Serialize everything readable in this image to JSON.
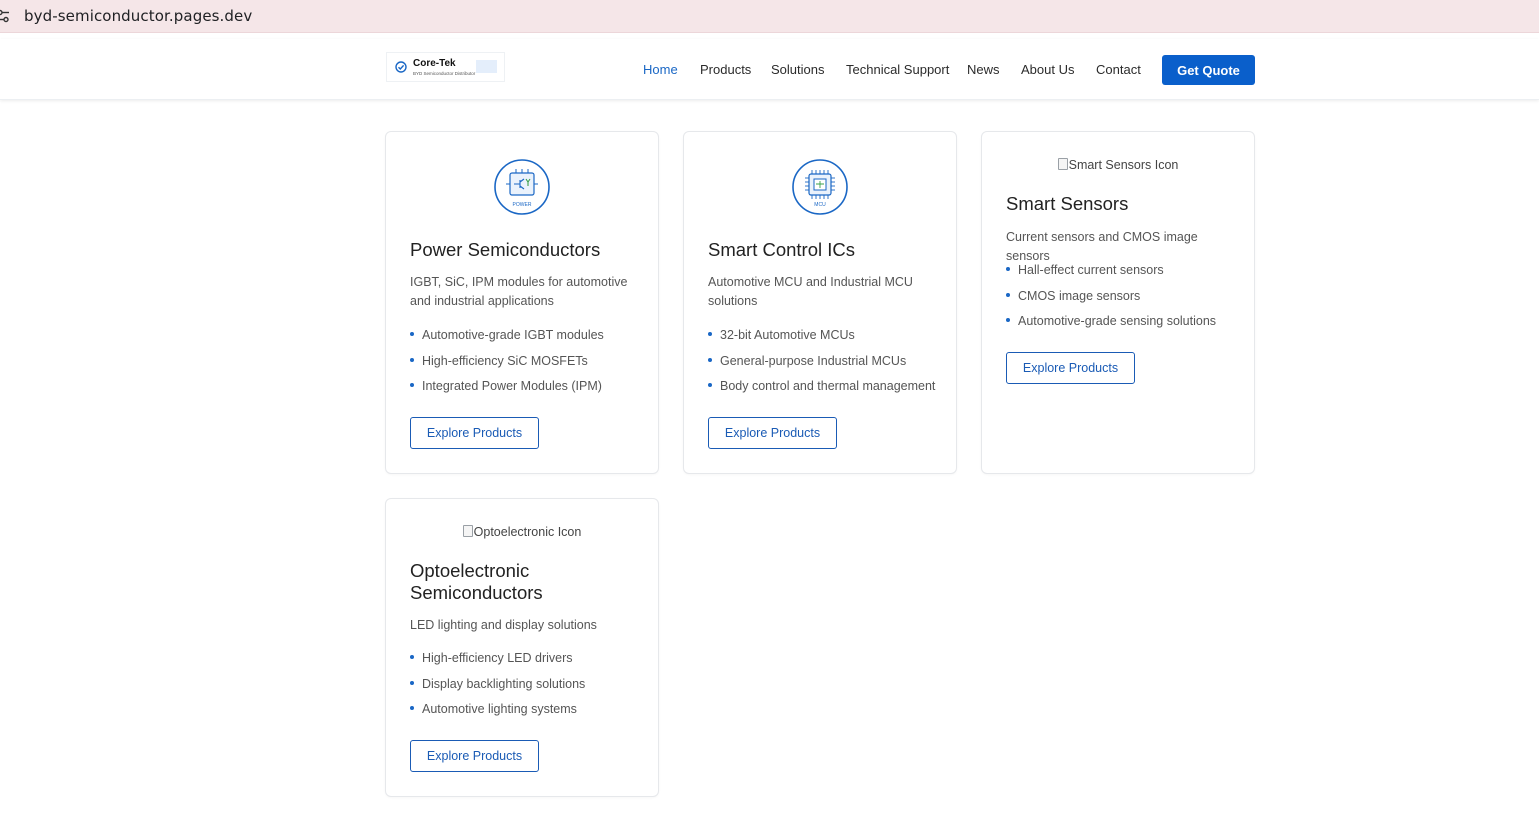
{
  "browser": {
    "url": "byd-semiconductor.pages.dev",
    "site_icon": "tune-icon"
  },
  "header": {
    "logo": {
      "name": "Core-Tek",
      "subtitle": "BYD Semiconductor Distributor",
      "icon": "check-circle-icon"
    },
    "nav": [
      {
        "label": "Home",
        "active": true
      },
      {
        "label": "Products",
        "active": false
      },
      {
        "label": "Solutions",
        "active": false
      },
      {
        "label": "Technical Support",
        "active": false
      },
      {
        "label": "News",
        "active": false
      },
      {
        "label": "About Us",
        "active": false
      },
      {
        "label": "Contact",
        "active": false
      }
    ],
    "cta_label": "Get Quote"
  },
  "colors": {
    "primary": "#0a5fcb",
    "link_active": "#1a67c5",
    "bullet": "#1a67c5",
    "urlbar_bg": "#f5e6e8"
  },
  "cards": [
    {
      "icon": {
        "type": "svg",
        "name": "power-chip-icon",
        "caption": "POWER"
      },
      "title": "Power Semiconductors",
      "description": "IGBT, SiC, IPM modules for automotive and industrial applications",
      "features": [
        "Automotive-grade IGBT modules",
        "High-efficiency SiC MOSFETs",
        "Integrated Power Modules (IPM)"
      ],
      "button": "Explore Products"
    },
    {
      "icon": {
        "type": "svg",
        "name": "mcu-chip-icon",
        "caption": "MCU"
      },
      "title": "Smart Control ICs",
      "description": "Automotive MCU and Industrial MCU solutions",
      "features": [
        "32-bit Automotive MCUs",
        "General-purpose Industrial MCUs",
        "Body control and thermal management"
      ],
      "button": "Explore Products"
    },
    {
      "icon": {
        "type": "broken",
        "alt": "Smart Sensors Icon"
      },
      "title": "Smart Sensors",
      "description": "Current sensors and CMOS image sensors",
      "features": [
        "Hall-effect current sensors",
        "CMOS image sensors",
        "Automotive-grade sensing solutions"
      ],
      "button": "Explore Products"
    },
    {
      "icon": {
        "type": "broken",
        "alt": "Optoelectronic Icon"
      },
      "title": "Optoelectronic Semiconductors",
      "description": "LED lighting and display solutions",
      "features": [
        "High-efficiency LED drivers",
        "Display backlighting solutions",
        "Automotive lighting systems"
      ],
      "button": "Explore Products"
    }
  ]
}
